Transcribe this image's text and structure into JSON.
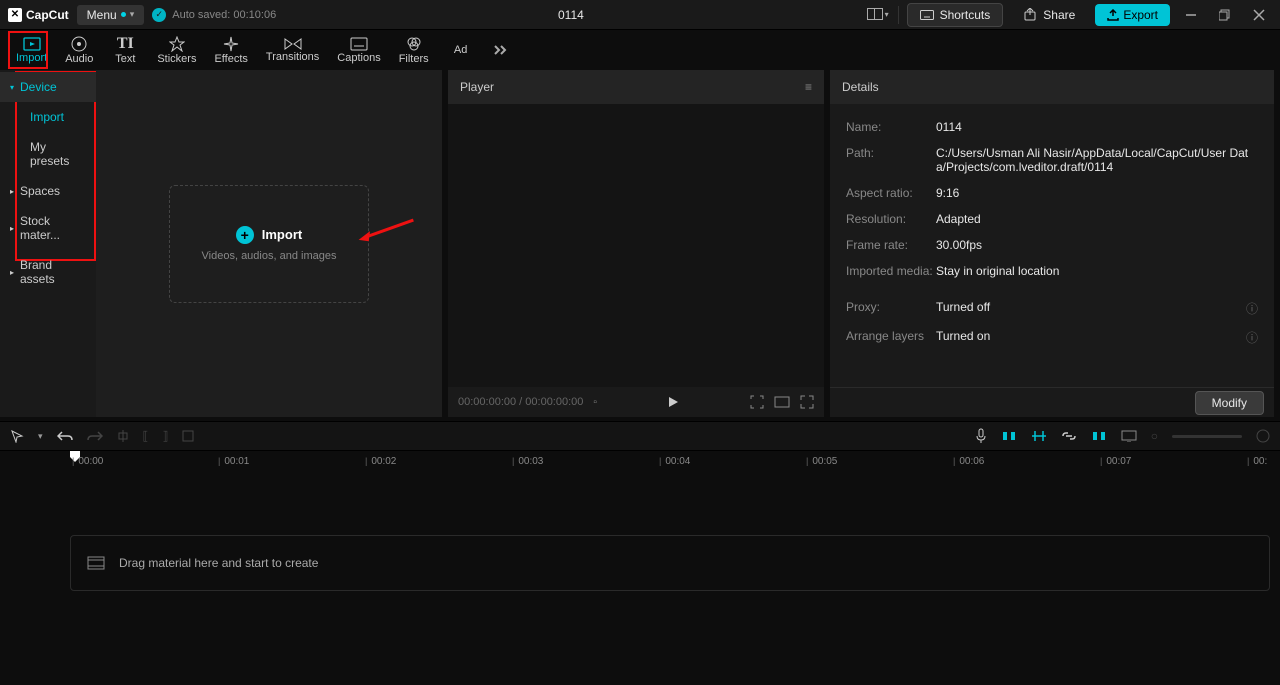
{
  "titlebar": {
    "app_name": "CapCut",
    "menu_label": "Menu",
    "autosave_label": "Auto saved: 00:10:06",
    "project_title": "0114",
    "shortcuts_label": "Shortcuts",
    "share_label": "Share",
    "export_label": "Export"
  },
  "tabs": [
    {
      "label": "Import",
      "icon": "▣"
    },
    {
      "label": "Audio",
      "icon": "◷"
    },
    {
      "label": "Text",
      "icon": "TI"
    },
    {
      "label": "Stickers",
      "icon": "☆"
    },
    {
      "label": "Effects",
      "icon": "✦"
    },
    {
      "label": "Transitions",
      "icon": "⋈"
    },
    {
      "label": "Captions",
      "icon": "⊟"
    },
    {
      "label": "Filters",
      "icon": "⊗"
    },
    {
      "label": "Ad",
      "icon": ""
    }
  ],
  "sidebar": {
    "items": [
      {
        "label": "Device",
        "expandable": true,
        "selected": true
      },
      {
        "label": "Import",
        "sub": true,
        "active": true
      },
      {
        "label": "My presets",
        "sub": true
      },
      {
        "label": "Spaces",
        "expandable": true
      },
      {
        "label": "Stock mater...",
        "expandable": true
      },
      {
        "label": "Brand assets",
        "expandable": true
      }
    ]
  },
  "import_box": {
    "title": "Import",
    "subtitle": "Videos, audios, and images"
  },
  "player": {
    "header": "Player",
    "time": "00:00:00:00 / 00:00:00:00"
  },
  "details": {
    "header": "Details",
    "rows": [
      {
        "label": "Name:",
        "value": "0114"
      },
      {
        "label": "Path:",
        "value": "C:/Users/Usman Ali Nasir/AppData/Local/CapCut/User Data/Projects/com.lveditor.draft/0114"
      },
      {
        "label": "Aspect ratio:",
        "value": "9:16"
      },
      {
        "label": "Resolution:",
        "value": "Adapted"
      },
      {
        "label": "Frame rate:",
        "value": "30.00fps"
      },
      {
        "label": "Imported media:",
        "value": "Stay in original location"
      }
    ],
    "rows2": [
      {
        "label": "Proxy:",
        "value": "Turned off",
        "info": true
      },
      {
        "label": "Arrange layers",
        "value": "Turned on",
        "info": true
      }
    ],
    "modify_label": "Modify"
  },
  "timeline": {
    "marks": [
      "00:00",
      "00:01",
      "00:02",
      "00:03",
      "00:04",
      "00:05",
      "00:06",
      "00:07",
      "00:"
    ],
    "track_hint": "Drag material here and start to create"
  }
}
